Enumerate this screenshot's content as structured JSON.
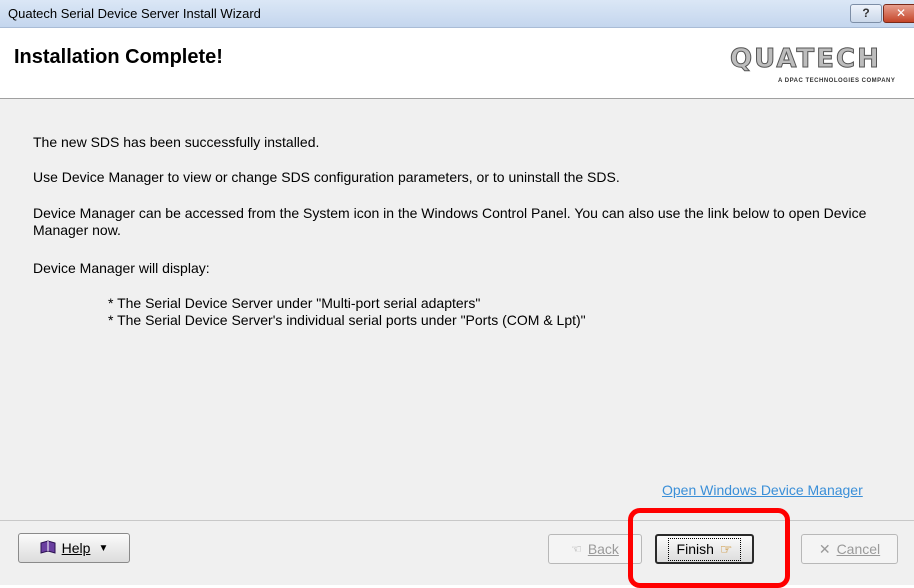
{
  "window": {
    "title": "Quatech Serial Device Server Install Wizard",
    "help_glyph": "?",
    "close_glyph": "✕"
  },
  "header": {
    "title": "Installation Complete!",
    "logo_text": "QUATECH",
    "logo_subtext": "A DPAC TECHNOLOGIES COMPANY"
  },
  "content": {
    "p1": "The new SDS has been successfully installed.",
    "p2": "Use Device Manager to view or change SDS configuration parameters, or to uninstall the SDS.",
    "p3": "Device Manager can be accessed from the System icon in the Windows Control Panel.  You can also use the link below to open Device Manager now.",
    "p4": "Device Manager will display:",
    "bullets": [
      "* The Serial Device Server under \"Multi-port serial adapters\"",
      "* The Serial Device Server's individual serial ports under \"Ports (COM & Lpt)\""
    ],
    "link": "Open Windows Device Manager"
  },
  "footer": {
    "help_label": "Help",
    "back_label": "Back",
    "finish_label": "Finish",
    "cancel_label": "Cancel"
  },
  "colors": {
    "link": "#3a8fd8",
    "highlight": "#ff0000"
  }
}
